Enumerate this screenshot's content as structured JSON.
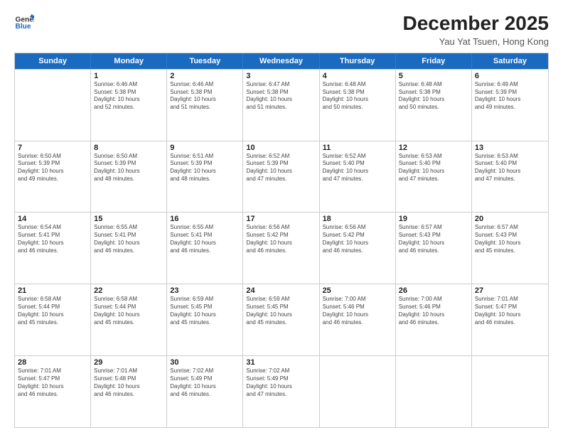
{
  "logo": {
    "line1": "General",
    "line2": "Blue"
  },
  "title": "December 2025",
  "subtitle": "Yau Yat Tsuen, Hong Kong",
  "days": [
    "Sunday",
    "Monday",
    "Tuesday",
    "Wednesday",
    "Thursday",
    "Friday",
    "Saturday"
  ],
  "weeks": [
    [
      {
        "day": "",
        "info": ""
      },
      {
        "day": "1",
        "info": "Sunrise: 6:46 AM\nSunset: 5:38 PM\nDaylight: 10 hours\nand 52 minutes."
      },
      {
        "day": "2",
        "info": "Sunrise: 6:46 AM\nSunset: 5:38 PM\nDaylight: 10 hours\nand 51 minutes."
      },
      {
        "day": "3",
        "info": "Sunrise: 6:47 AM\nSunset: 5:38 PM\nDaylight: 10 hours\nand 51 minutes."
      },
      {
        "day": "4",
        "info": "Sunrise: 6:48 AM\nSunset: 5:38 PM\nDaylight: 10 hours\nand 50 minutes."
      },
      {
        "day": "5",
        "info": "Sunrise: 6:48 AM\nSunset: 5:38 PM\nDaylight: 10 hours\nand 50 minutes."
      },
      {
        "day": "6",
        "info": "Sunrise: 6:49 AM\nSunset: 5:39 PM\nDaylight: 10 hours\nand 49 minutes."
      }
    ],
    [
      {
        "day": "7",
        "info": "Sunrise: 6:50 AM\nSunset: 5:39 PM\nDaylight: 10 hours\nand 49 minutes."
      },
      {
        "day": "8",
        "info": "Sunrise: 6:50 AM\nSunset: 5:39 PM\nDaylight: 10 hours\nand 48 minutes."
      },
      {
        "day": "9",
        "info": "Sunrise: 6:51 AM\nSunset: 5:39 PM\nDaylight: 10 hours\nand 48 minutes."
      },
      {
        "day": "10",
        "info": "Sunrise: 6:52 AM\nSunset: 5:39 PM\nDaylight: 10 hours\nand 47 minutes."
      },
      {
        "day": "11",
        "info": "Sunrise: 6:52 AM\nSunset: 5:40 PM\nDaylight: 10 hours\nand 47 minutes."
      },
      {
        "day": "12",
        "info": "Sunrise: 6:53 AM\nSunset: 5:40 PM\nDaylight: 10 hours\nand 47 minutes."
      },
      {
        "day": "13",
        "info": "Sunrise: 6:53 AM\nSunset: 5:40 PM\nDaylight: 10 hours\nand 47 minutes."
      }
    ],
    [
      {
        "day": "14",
        "info": "Sunrise: 6:54 AM\nSunset: 5:41 PM\nDaylight: 10 hours\nand 46 minutes."
      },
      {
        "day": "15",
        "info": "Sunrise: 6:55 AM\nSunset: 5:41 PM\nDaylight: 10 hours\nand 46 minutes."
      },
      {
        "day": "16",
        "info": "Sunrise: 6:55 AM\nSunset: 5:41 PM\nDaylight: 10 hours\nand 46 minutes."
      },
      {
        "day": "17",
        "info": "Sunrise: 6:56 AM\nSunset: 5:42 PM\nDaylight: 10 hours\nand 46 minutes."
      },
      {
        "day": "18",
        "info": "Sunrise: 6:56 AM\nSunset: 5:42 PM\nDaylight: 10 hours\nand 46 minutes."
      },
      {
        "day": "19",
        "info": "Sunrise: 6:57 AM\nSunset: 5:43 PM\nDaylight: 10 hours\nand 46 minutes."
      },
      {
        "day": "20",
        "info": "Sunrise: 6:57 AM\nSunset: 5:43 PM\nDaylight: 10 hours\nand 45 minutes."
      }
    ],
    [
      {
        "day": "21",
        "info": "Sunrise: 6:58 AM\nSunset: 5:44 PM\nDaylight: 10 hours\nand 45 minutes."
      },
      {
        "day": "22",
        "info": "Sunrise: 6:58 AM\nSunset: 5:44 PM\nDaylight: 10 hours\nand 45 minutes."
      },
      {
        "day": "23",
        "info": "Sunrise: 6:59 AM\nSunset: 5:45 PM\nDaylight: 10 hours\nand 45 minutes."
      },
      {
        "day": "24",
        "info": "Sunrise: 6:59 AM\nSunset: 5:45 PM\nDaylight: 10 hours\nand 45 minutes."
      },
      {
        "day": "25",
        "info": "Sunrise: 7:00 AM\nSunset: 5:46 PM\nDaylight: 10 hours\nand 46 minutes."
      },
      {
        "day": "26",
        "info": "Sunrise: 7:00 AM\nSunset: 5:46 PM\nDaylight: 10 hours\nand 46 minutes."
      },
      {
        "day": "27",
        "info": "Sunrise: 7:01 AM\nSunset: 5:47 PM\nDaylight: 10 hours\nand 46 minutes."
      }
    ],
    [
      {
        "day": "28",
        "info": "Sunrise: 7:01 AM\nSunset: 5:47 PM\nDaylight: 10 hours\nand 46 minutes."
      },
      {
        "day": "29",
        "info": "Sunrise: 7:01 AM\nSunset: 5:48 PM\nDaylight: 10 hours\nand 46 minutes."
      },
      {
        "day": "30",
        "info": "Sunrise: 7:02 AM\nSunset: 5:49 PM\nDaylight: 10 hours\nand 46 minutes."
      },
      {
        "day": "31",
        "info": "Sunrise: 7:02 AM\nSunset: 5:49 PM\nDaylight: 10 hours\nand 47 minutes."
      },
      {
        "day": "",
        "info": ""
      },
      {
        "day": "",
        "info": ""
      },
      {
        "day": "",
        "info": ""
      }
    ]
  ]
}
